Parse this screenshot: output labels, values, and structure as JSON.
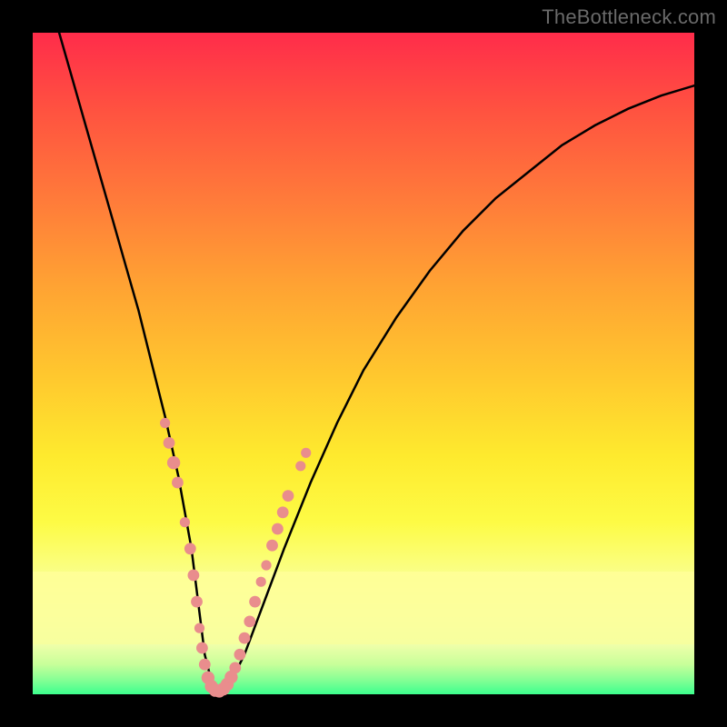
{
  "attribution": "TheBottleneck.com",
  "chart_data": {
    "type": "line",
    "title": "",
    "xlabel": "",
    "ylabel": "",
    "xlim": [
      0,
      100
    ],
    "ylim": [
      0,
      100
    ],
    "series": [
      {
        "name": "bottleneck-curve",
        "x": [
          4,
          6,
          8,
          10,
          12,
          14,
          16,
          18,
          20,
          22,
          24,
          25,
          26,
          27,
          28,
          30,
          32,
          35,
          38,
          42,
          46,
          50,
          55,
          60,
          65,
          70,
          75,
          80,
          85,
          90,
          95,
          100
        ],
        "values": [
          100,
          93,
          86,
          79,
          72,
          65,
          58,
          50,
          42,
          33,
          22,
          14,
          6,
          2,
          0.5,
          2,
          6,
          14,
          22,
          32,
          41,
          49,
          57,
          64,
          70,
          75,
          79,
          83,
          86,
          88.5,
          90.5,
          92
        ]
      }
    ],
    "markers": {
      "name": "highlighted-points",
      "color": "#e98d8d",
      "points": [
        {
          "x": 20.0,
          "y": 41.0,
          "r": 3.5
        },
        {
          "x": 20.6,
          "y": 38.0,
          "r": 4.0
        },
        {
          "x": 21.3,
          "y": 35.0,
          "r": 4.5
        },
        {
          "x": 21.9,
          "y": 32.0,
          "r": 4.0
        },
        {
          "x": 23.0,
          "y": 26.0,
          "r": 3.5
        },
        {
          "x": 23.8,
          "y": 22.0,
          "r": 4.0
        },
        {
          "x": 24.3,
          "y": 18.0,
          "r": 4.0
        },
        {
          "x": 24.8,
          "y": 14.0,
          "r": 4.0
        },
        {
          "x": 25.2,
          "y": 10.0,
          "r": 3.5
        },
        {
          "x": 25.6,
          "y": 7.0,
          "r": 4.0
        },
        {
          "x": 26.0,
          "y": 4.5,
          "r": 4.0
        },
        {
          "x": 26.5,
          "y": 2.5,
          "r": 4.5
        },
        {
          "x": 27.0,
          "y": 1.2,
          "r": 4.5
        },
        {
          "x": 27.6,
          "y": 0.6,
          "r": 4.5
        },
        {
          "x": 28.2,
          "y": 0.5,
          "r": 4.5
        },
        {
          "x": 28.8,
          "y": 0.8,
          "r": 4.5
        },
        {
          "x": 29.4,
          "y": 1.5,
          "r": 4.5
        },
        {
          "x": 30.0,
          "y": 2.6,
          "r": 4.5
        },
        {
          "x": 30.6,
          "y": 4.0,
          "r": 4.0
        },
        {
          "x": 31.3,
          "y": 6.0,
          "r": 4.0
        },
        {
          "x": 32.0,
          "y": 8.5,
          "r": 4.0
        },
        {
          "x": 32.8,
          "y": 11.0,
          "r": 4.0
        },
        {
          "x": 33.6,
          "y": 14.0,
          "r": 4.0
        },
        {
          "x": 34.5,
          "y": 17.0,
          "r": 3.5
        },
        {
          "x": 35.3,
          "y": 19.5,
          "r": 3.5
        },
        {
          "x": 36.2,
          "y": 22.5,
          "r": 4.0
        },
        {
          "x": 37.0,
          "y": 25.0,
          "r": 4.0
        },
        {
          "x": 37.8,
          "y": 27.5,
          "r": 4.0
        },
        {
          "x": 38.6,
          "y": 30.0,
          "r": 4.0
        },
        {
          "x": 40.5,
          "y": 34.5,
          "r": 3.5
        },
        {
          "x": 41.3,
          "y": 36.5,
          "r": 3.5
        }
      ]
    },
    "gradient_stops": [
      {
        "pos": 0,
        "color": "#ff2c4a"
      },
      {
        "pos": 52,
        "color": "#ffc82e"
      },
      {
        "pos": 74,
        "color": "#fdfb45"
      },
      {
        "pos": 100,
        "color": "#3eff99"
      }
    ],
    "highlight_bands": [
      {
        "y_from": 7.5,
        "y_to": 18.5,
        "color": "#ffff99"
      },
      {
        "y_from": 0,
        "y_to": 7.5,
        "color": "gradient-green"
      }
    ]
  }
}
